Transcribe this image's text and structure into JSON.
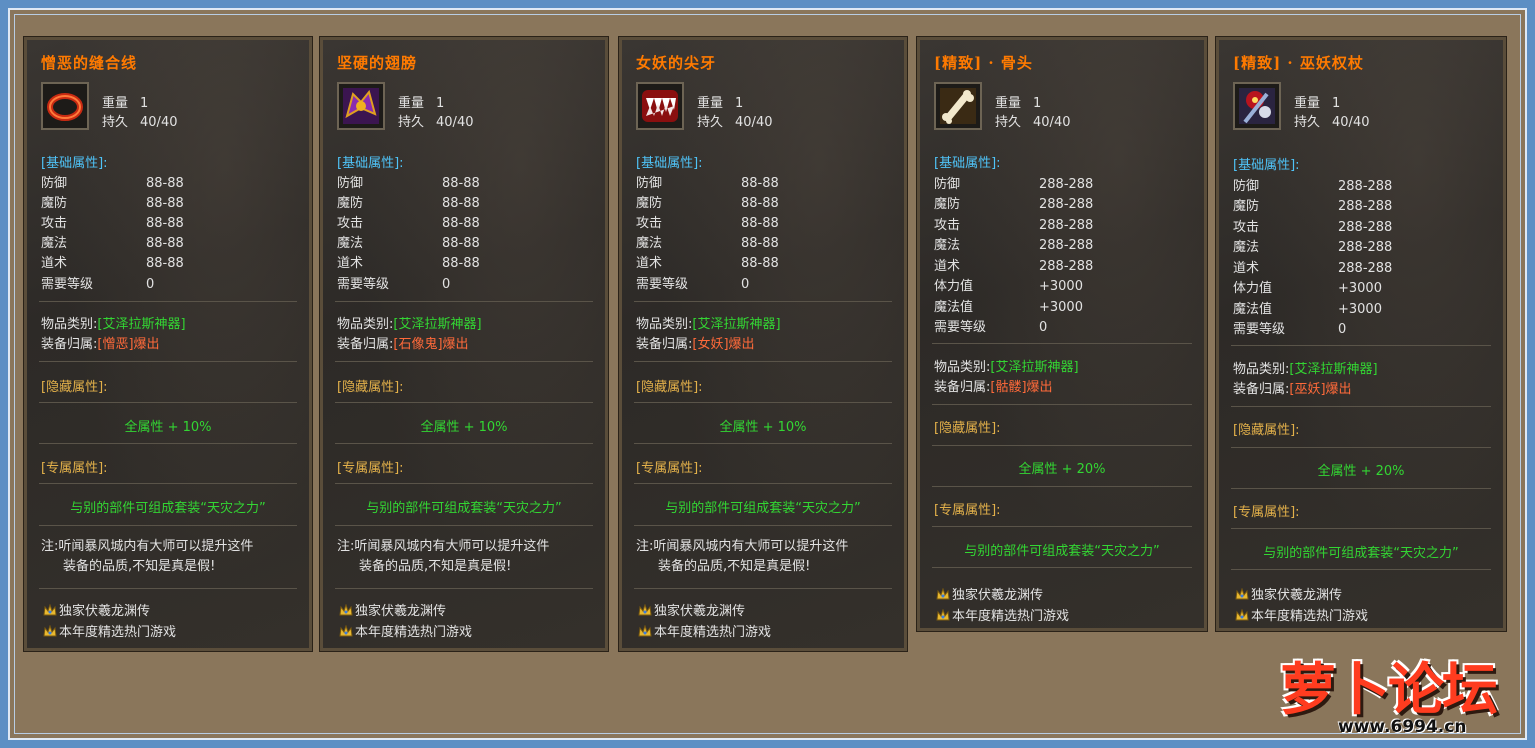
{
  "items": [
    {
      "title": "憎恶的缝合线",
      "icon": "red-ring-icon",
      "weight_label": "重量",
      "weight": "1",
      "durability_label": "持久",
      "durability": "40/40",
      "base_header": "[基础属性]:",
      "stats": [
        {
          "k": "防御",
          "v": "88-88"
        },
        {
          "k": "魔防",
          "v": "88-88"
        },
        {
          "k": "攻击",
          "v": "88-88"
        },
        {
          "k": "魔法",
          "v": "88-88"
        },
        {
          "k": "道术",
          "v": "88-88"
        },
        {
          "k": "需要等级",
          "v": "0"
        }
      ],
      "type_label": "物品类别:",
      "type_value": "[艾泽拉斯神器]",
      "owner_label": "装备归属:",
      "owner_value": "[憎恶]爆出",
      "hidden_header": "[隐藏属性]:",
      "hidden_value": "全属性 + 10%",
      "exclusive_header": "[专属属性]:",
      "exclusive_value": "与别的部件可组成套装“天灾之力”",
      "note_line1": "注:听闻暴风城内有大师可以提升这件",
      "note_line2": "装备的品质,不知是真是假!",
      "ad1": "独家伏羲龙渊传",
      "ad2": "本年度精选热门游戏"
    },
    {
      "title": "坚硬的翅膀",
      "icon": "purple-wing-icon",
      "weight_label": "重量",
      "weight": "1",
      "durability_label": "持久",
      "durability": "40/40",
      "base_header": "[基础属性]:",
      "stats": [
        {
          "k": "防御",
          "v": "88-88"
        },
        {
          "k": "魔防",
          "v": "88-88"
        },
        {
          "k": "攻击",
          "v": "88-88"
        },
        {
          "k": "魔法",
          "v": "88-88"
        },
        {
          "k": "道术",
          "v": "88-88"
        },
        {
          "k": "需要等级",
          "v": "0"
        }
      ],
      "type_label": "物品类别:",
      "type_value": "[艾泽拉斯神器]",
      "owner_label": "装备归属:",
      "owner_value": "[石像鬼]爆出",
      "hidden_header": "[隐藏属性]:",
      "hidden_value": "全属性 + 10%",
      "exclusive_header": "[专属属性]:",
      "exclusive_value": "与别的部件可组成套装“天灾之力”",
      "note_line1": "注:听闻暴风城内有大师可以提升这件",
      "note_line2": "装备的品质,不知是真是假!",
      "ad1": "独家伏羲龙渊传",
      "ad2": "本年度精选热门游戏"
    },
    {
      "title": "女妖的尖牙",
      "icon": "fang-icon",
      "weight_label": "重量",
      "weight": "1",
      "durability_label": "持久",
      "durability": "40/40",
      "base_header": "[基础属性]:",
      "stats": [
        {
          "k": "防御",
          "v": "88-88"
        },
        {
          "k": "魔防",
          "v": "88-88"
        },
        {
          "k": "攻击",
          "v": "88-88"
        },
        {
          "k": "魔法",
          "v": "88-88"
        },
        {
          "k": "道术",
          "v": "88-88"
        },
        {
          "k": "需要等级",
          "v": "0"
        }
      ],
      "type_label": "物品类别:",
      "type_value": "[艾泽拉斯神器]",
      "owner_label": "装备归属:",
      "owner_value": "[女妖]爆出",
      "hidden_header": "[隐藏属性]:",
      "hidden_value": "全属性 + 10%",
      "exclusive_header": "[专属属性]:",
      "exclusive_value": "与别的部件可组成套装“天灾之力”",
      "note_line1": "注:听闻暴风城内有大师可以提升这件",
      "note_line2": "装备的品质,不知是真是假!",
      "ad1": "独家伏羲龙渊传",
      "ad2": "本年度精选热门游戏"
    },
    {
      "title": "[精致] · 骨头",
      "icon": "bone-icon",
      "weight_label": "重量",
      "weight": "1",
      "durability_label": "持久",
      "durability": "40/40",
      "base_header": "[基础属性]:",
      "stats": [
        {
          "k": "防御",
          "v": "288-288"
        },
        {
          "k": "魔防",
          "v": "288-288"
        },
        {
          "k": "攻击",
          "v": "288-288"
        },
        {
          "k": "魔法",
          "v": "288-288"
        },
        {
          "k": "道术",
          "v": "288-288"
        },
        {
          "k": "体力值",
          "v": "+3000"
        },
        {
          "k": "魔法值",
          "v": "+3000"
        },
        {
          "k": "需要等级",
          "v": "0"
        }
      ],
      "type_label": "物品类别:",
      "type_value": "[艾泽拉斯神器]",
      "owner_label": "装备归属:",
      "owner_value": "[骷髅]爆出",
      "hidden_header": "[隐藏属性]:",
      "hidden_value": "全属性 + 20%",
      "exclusive_header": "[专属属性]:",
      "exclusive_value": "与别的部件可组成套装“天灾之力”",
      "ad1": "独家伏羲龙渊传",
      "ad2": "本年度精选热门游戏"
    },
    {
      "title": "[精致] · 巫妖权杖",
      "icon": "lich-staff-icon",
      "weight_label": "重量",
      "weight": "1",
      "durability_label": "持久",
      "durability": "40/40",
      "base_header": "[基础属性]:",
      "stats": [
        {
          "k": "防御",
          "v": "288-288"
        },
        {
          "k": "魔防",
          "v": "288-288"
        },
        {
          "k": "攻击",
          "v": "288-288"
        },
        {
          "k": "魔法",
          "v": "288-288"
        },
        {
          "k": "道术",
          "v": "288-288"
        },
        {
          "k": "体力值",
          "v": "+3000"
        },
        {
          "k": "魔法值",
          "v": "+3000"
        },
        {
          "k": "需要等级",
          "v": "0"
        }
      ],
      "type_label": "物品类别:",
      "type_value": "[艾泽拉斯神器]",
      "owner_label": "装备归属:",
      "owner_value": "[巫妖]爆出",
      "hidden_header": "[隐藏属性]:",
      "hidden_value": "全属性 + 20%",
      "exclusive_header": "[专属属性]:",
      "exclusive_value": "与别的部件可组成套装“天灾之力”",
      "ad1": "独家伏羲龙渊传",
      "ad2": "本年度精选热门游戏"
    }
  ],
  "watermark": {
    "text": "萝卜论坛",
    "url": "www.6994.cn"
  }
}
